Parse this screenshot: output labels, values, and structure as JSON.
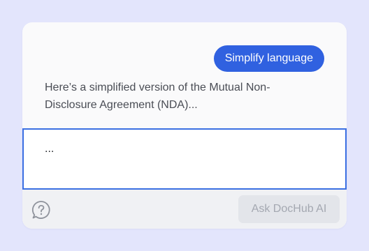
{
  "chat": {
    "user_message": "Simplify language",
    "ai_reply": "Here’s a simplified version of the Mutual Non-Disclosure Agreement (NDA)...",
    "input_value": "..."
  },
  "footer": {
    "help_icon": "question-bubble-icon",
    "ask_button_label": "Ask DocHub AI"
  },
  "colors": {
    "background": "#e3e5fc",
    "accent": "#3061e0",
    "input_border": "#3b6fe2",
    "disabled_button": "#e3e5ea"
  }
}
